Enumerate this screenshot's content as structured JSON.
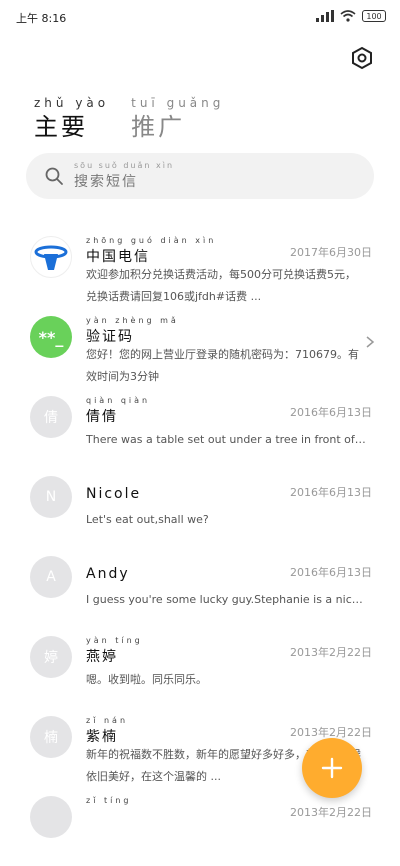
{
  "status": {
    "time": "上午 8:16",
    "battery": "100"
  },
  "tabs": [
    {
      "pinyin": "zhǔ yào",
      "label": "主要"
    },
    {
      "pinyin": "tuī guǎng",
      "label": "推广"
    }
  ],
  "search": {
    "pinyin": "sōu suǒ duǎn xìn",
    "placeholder": "搜索短信"
  },
  "conversations": [
    {
      "avatar": "",
      "name_pinyin": "zhōng guó diàn xìn",
      "name": "中国电信",
      "date": "2017年6月30日",
      "preview": "欢迎参加积分兑换话费活动，每500分可兑换话费5元，兑换话费请回复106或jfdh#话费 ..."
    },
    {
      "avatar": "**_",
      "name_pinyin": "yàn zhèng mǎ",
      "name": "验证码",
      "date": "",
      "preview": "您好！您的网上营业厅登录的随机密码为：710679。有效时间为3分钟"
    },
    {
      "avatar": "倩",
      "name_pinyin": "qiàn qiàn",
      "name": "倩倩",
      "date": "2016年6月13日",
      "preview": "There was a table set out under a tree in front of the hous"
    },
    {
      "avatar": "N",
      "name_pinyin": "",
      "name": "Nicole",
      "date": "2016年6月13日",
      "preview": "Let's eat out,shall we?"
    },
    {
      "avatar": "A",
      "name_pinyin": "",
      "name": "Andy",
      "date": "2016年6月13日",
      "preview": "I guess you're some lucky guy.Stephanie is a nice girl."
    },
    {
      "avatar": "婷",
      "name_pinyin": "yàn tíng",
      "name": "燕婷",
      "date": "2013年2月22日",
      "preview": "嗯。收到啦。同乐同乐。"
    },
    {
      "avatar": "楠",
      "name_pinyin": "zǐ nán",
      "name": "紫楠",
      "date": "2013年2月22日",
      "preview": "新年的祝福数不胜数，新年的愿望好多好多，新年的问候依旧美好，在这个温馨的 ..."
    },
    {
      "avatar": "",
      "name_pinyin": "zǐ tíng",
      "name": "",
      "date": "2013年2月22日",
      "preview": ""
    }
  ]
}
